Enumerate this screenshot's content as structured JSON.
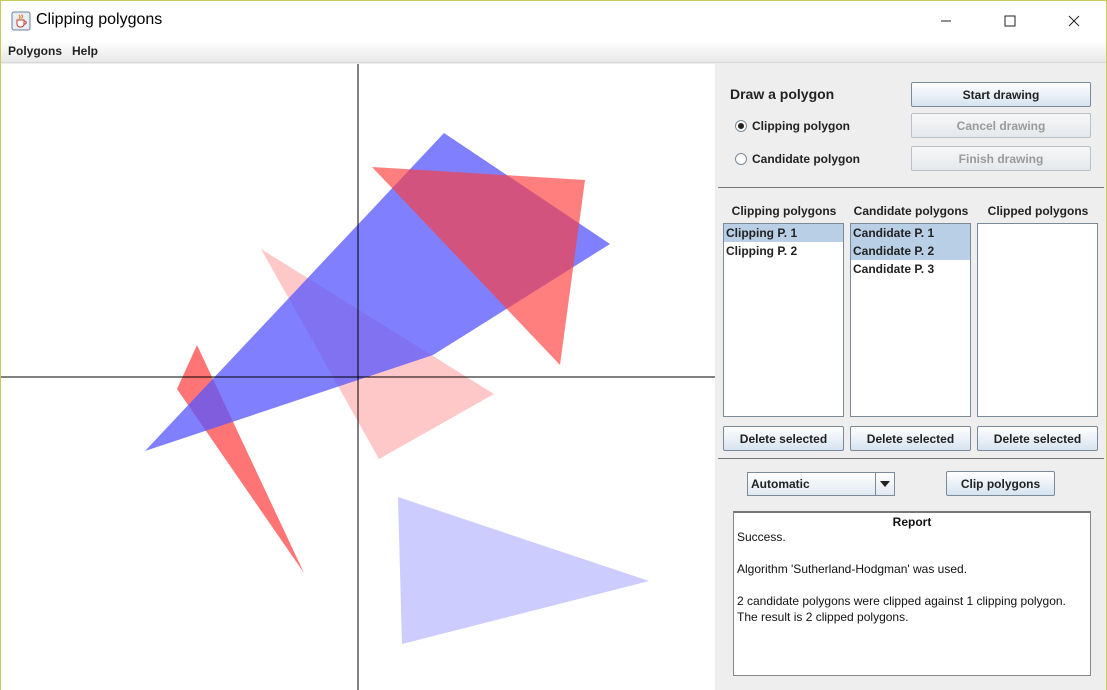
{
  "window": {
    "title": "Clipping polygons",
    "icon": "java-cup-icon"
  },
  "menu": {
    "items": [
      {
        "label": "Polygons"
      },
      {
        "label": "Help"
      }
    ]
  },
  "draw": {
    "section_title": "Draw a polygon",
    "start_label": "Start drawing",
    "cancel_label": "Cancel drawing",
    "finish_label": "Finish drawing",
    "radio_clipping": "Clipping polygon",
    "radio_candidate": "Candidate polygon",
    "selected_radio": "Clipping polygon"
  },
  "lists": {
    "clipping": {
      "header": "Clipping polygons",
      "items": [
        {
          "label": "Clipping P. 1",
          "selected": true
        },
        {
          "label": "Clipping P. 2",
          "selected": false
        }
      ]
    },
    "candidate": {
      "header": "Candidate polygons",
      "items": [
        {
          "label": "Candidate P. 1",
          "selected": true
        },
        {
          "label": "Candidate P. 2",
          "selected": true
        },
        {
          "label": "Candidate P. 3",
          "selected": false
        }
      ]
    },
    "clipped": {
      "header": "Clipped polygons",
      "items": []
    },
    "delete_label": "Delete selected"
  },
  "clip": {
    "algorithm_value": "Automatic",
    "clip_label": "Clip polygons"
  },
  "report": {
    "title": "Report",
    "lines": [
      "Success.",
      "",
      "Algorithm 'Sutherland-Hodgman' was used.",
      "",
      "2 candidate polygons were clipped against 1 clipping polygon.",
      "The result is 2 clipped polygons."
    ]
  },
  "colors": {
    "clipping_fill": "#5555ff",
    "candidate_fill": "#ff3b3b",
    "candidate_light": "#ffb0b0",
    "clipping_light": "#b0b0ff",
    "selection": "#b8cfe5"
  }
}
